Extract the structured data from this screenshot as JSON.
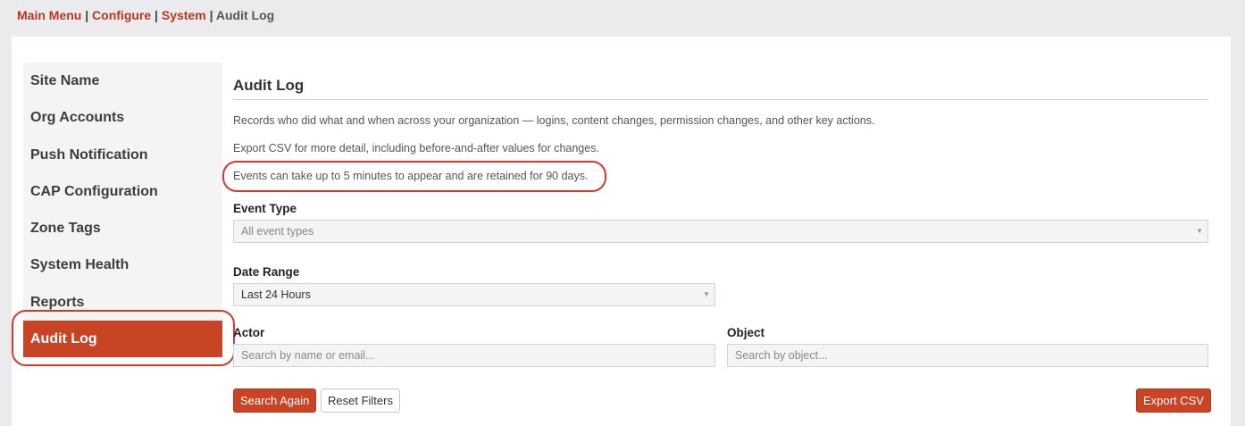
{
  "breadcrumb": {
    "items": [
      "Main Menu",
      "Configure",
      "System"
    ],
    "current": "Audit Log",
    "separator": "|"
  },
  "sidebar": {
    "items": [
      {
        "label": "Site Name"
      },
      {
        "label": "Org Accounts"
      },
      {
        "label": "Push Notification"
      },
      {
        "label": "CAP Configuration"
      },
      {
        "label": "Zone Tags"
      },
      {
        "label": "System Health"
      },
      {
        "label": "Reports"
      },
      {
        "label": "Audit Log",
        "active": true
      }
    ]
  },
  "main": {
    "title": "Audit Log",
    "desc1": "Records who did what and when across your organization — logins, content changes, permission changes, and other key actions.",
    "desc2": "Export CSV for more detail, including before-and-after values for changes.",
    "desc3": "Events can take up to 5 minutes to appear and are retained for 90 days.",
    "event_type_label": "Event Type",
    "event_type_value": "All event types",
    "date_range_label": "Date Range",
    "date_range_value": "Last 24 Hours",
    "actor_label": "Actor",
    "actor_placeholder": "Search by name or email...",
    "object_label": "Object",
    "object_placeholder": "Search by object...",
    "search_again": "Search Again",
    "reset_filters": "Reset Filters",
    "export_csv": "Export CSV"
  },
  "colors": {
    "accent": "#c84425",
    "annotation": "#d63a2a",
    "link": "#b5381f"
  }
}
